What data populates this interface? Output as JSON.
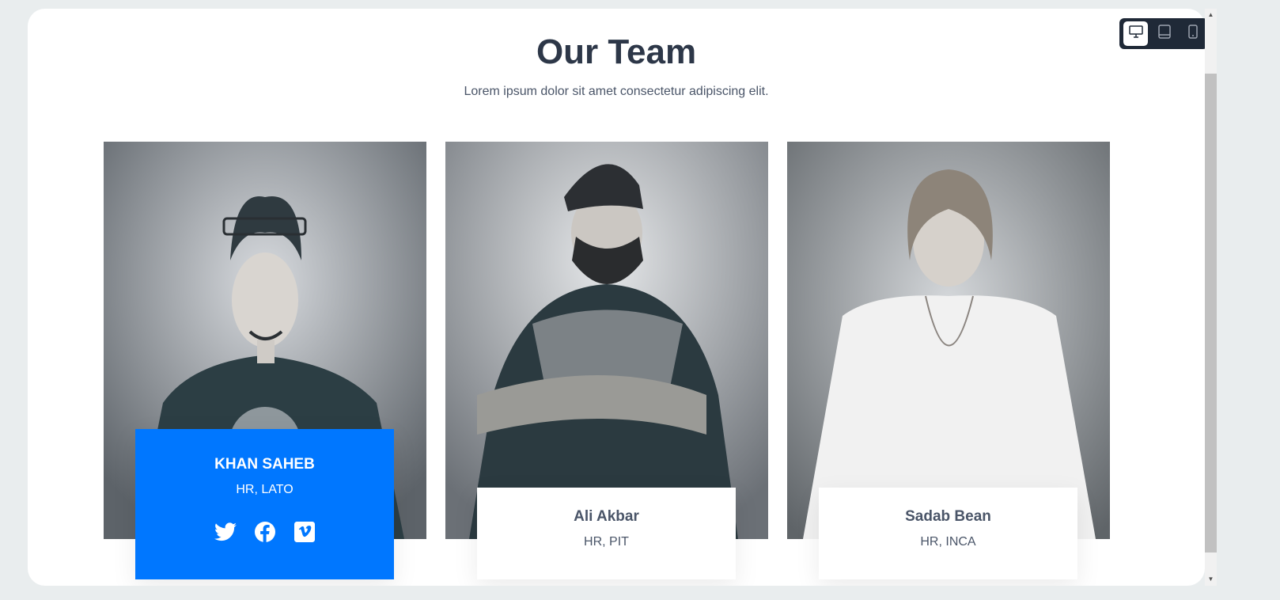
{
  "header": {
    "title": "Our Team",
    "subtitle": "Lorem ipsum dolor sit amet consectetur adipiscing elit."
  },
  "device_toggle": {
    "options": [
      "desktop-icon",
      "tablet-icon",
      "mobile-icon"
    ],
    "selected": "desktop"
  },
  "team": [
    {
      "name": "KHAN SAHEB",
      "role": "HR, LATO",
      "highlighted": true,
      "social": [
        "twitter-icon",
        "facebook-icon",
        "vimeo-icon"
      ]
    },
    {
      "name": "Ali Akbar",
      "role": "HR, PIT",
      "highlighted": false
    },
    {
      "name": "Sadab Bean",
      "role": "HR, INCA",
      "highlighted": false
    }
  ],
  "colors": {
    "accent": "#0077ff",
    "title": "#2d3748",
    "text": "#4a5568",
    "toggle_bg": "#1f2937"
  }
}
